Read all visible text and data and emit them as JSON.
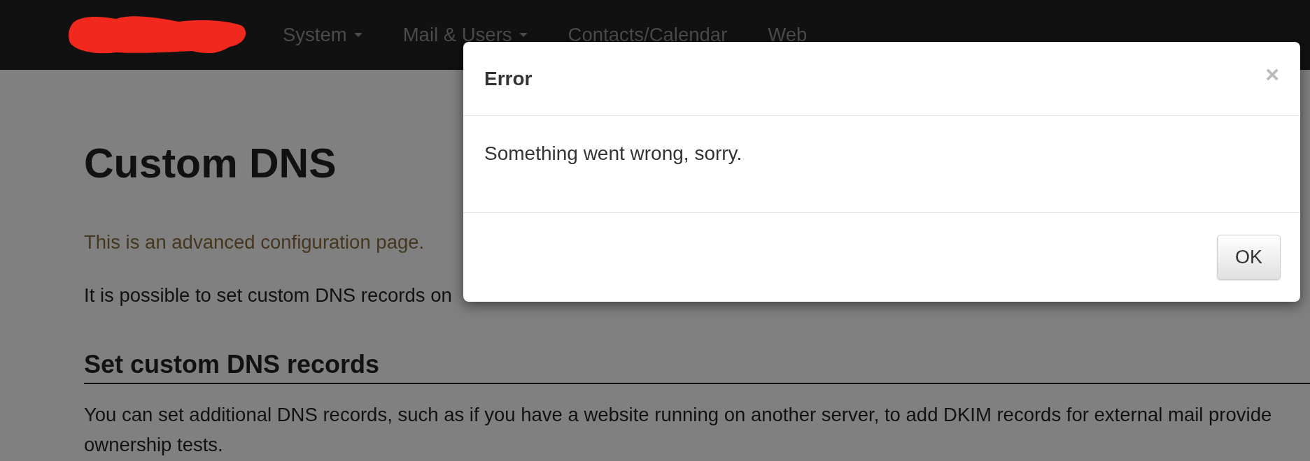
{
  "navbar": {
    "items": [
      {
        "label": "System",
        "dropdown": true
      },
      {
        "label": "Mail & Users",
        "dropdown": true
      },
      {
        "label": "Contacts/Calendar",
        "dropdown": false
      },
      {
        "label": "Web",
        "dropdown": false
      }
    ]
  },
  "page": {
    "title": "Custom DNS",
    "notice": "This is an advanced configuration page.",
    "intro": "It is possible to set custom DNS records on",
    "section_title": "Set custom DNS records",
    "section_text": "You can set additional DNS records, such as if you have a website running on another server, to add DKIM records for external mail provide\nownership tests."
  },
  "modal": {
    "title": "Error",
    "close": "×",
    "message": "Something went wrong, sorry.",
    "buttons": [
      "OK"
    ]
  }
}
